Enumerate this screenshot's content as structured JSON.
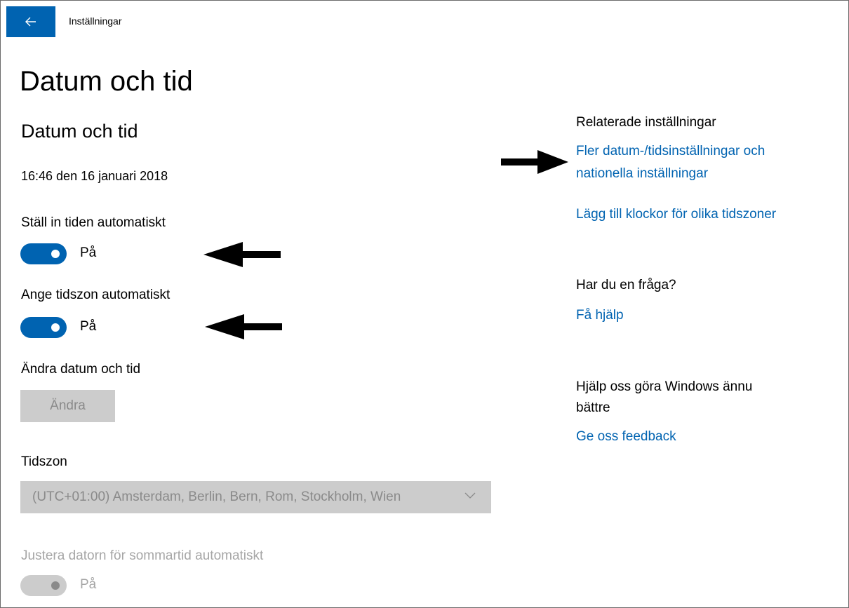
{
  "window": {
    "title": "Inställningar"
  },
  "page": {
    "title": "Datum och tid"
  },
  "date_time": {
    "section_title": "Datum och tid",
    "current": "16:46 den 16 januari 2018"
  },
  "auto_time": {
    "label": "Ställ in tiden automatiskt",
    "state": "På",
    "on": true
  },
  "auto_timezone": {
    "label": "Ange tidszon automatiskt",
    "state": "På",
    "on": true
  },
  "change_datetime": {
    "label": "Ändra datum och tid",
    "button": "Ändra"
  },
  "timezone": {
    "label": "Tidszon",
    "selected": "(UTC+01:00) Amsterdam, Berlin, Bern, Rom, Stockholm, Wien"
  },
  "dst": {
    "label": "Justera datorn för sommartid automatiskt",
    "state": "På",
    "enabled": false
  },
  "related": {
    "heading": "Relaterade inställningar",
    "link1_line1": "Fler datum-/tidsinställningar och",
    "link1_line2": "nationella inställningar",
    "link2": "Lägg till klockor för olika tidszoner"
  },
  "help": {
    "heading": "Har du en fråga?",
    "link": "Få hjälp"
  },
  "feedback": {
    "heading_line1": "Hjälp oss göra Windows ännu",
    "heading_line2": "bättre",
    "link": "Ge oss feedback"
  },
  "colors": {
    "accent": "#0063b1",
    "disabled": "#cccccc"
  }
}
